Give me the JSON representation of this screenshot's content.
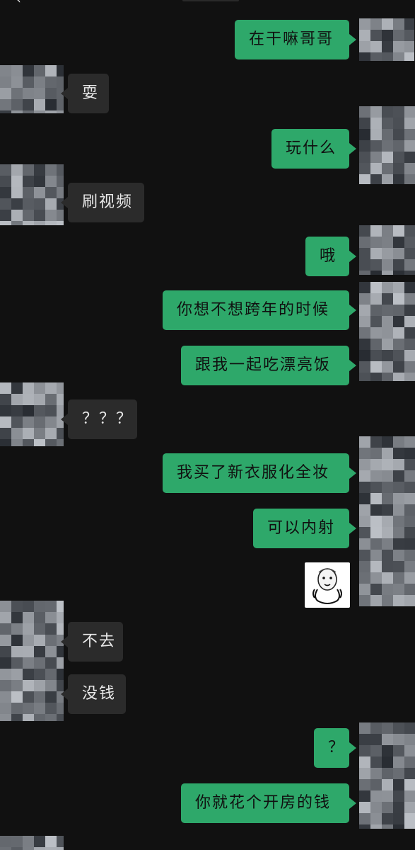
{
  "header": {
    "back_icon": "back-arrow-icon"
  },
  "messages": [
    {
      "from": "me",
      "text": "在干嘛哥哥"
    },
    {
      "from": "other",
      "text": "耍"
    },
    {
      "from": "me",
      "text": "玩什么"
    },
    {
      "from": "other",
      "text": "刷视频"
    },
    {
      "from": "me",
      "text": "哦"
    },
    {
      "from": "me",
      "text": "你想不想跨年的时候"
    },
    {
      "from": "me",
      "text": "跟我一起吃漂亮饭"
    },
    {
      "from": "other",
      "text": "？？？"
    },
    {
      "from": "me",
      "text": "我买了新衣服化全妆"
    },
    {
      "from": "me",
      "text": "可以内射"
    },
    {
      "from": "me",
      "type": "sticker",
      "icon": "face-sticker-icon"
    },
    {
      "from": "other",
      "text": "不去"
    },
    {
      "from": "other",
      "text": "没钱"
    },
    {
      "from": "me",
      "text": "？"
    },
    {
      "from": "me",
      "text": "你就花个开房的钱"
    }
  ],
  "colors": {
    "background": "#111111",
    "my_bubble": "#2ea86a",
    "their_bubble": "#2b2b2b"
  }
}
